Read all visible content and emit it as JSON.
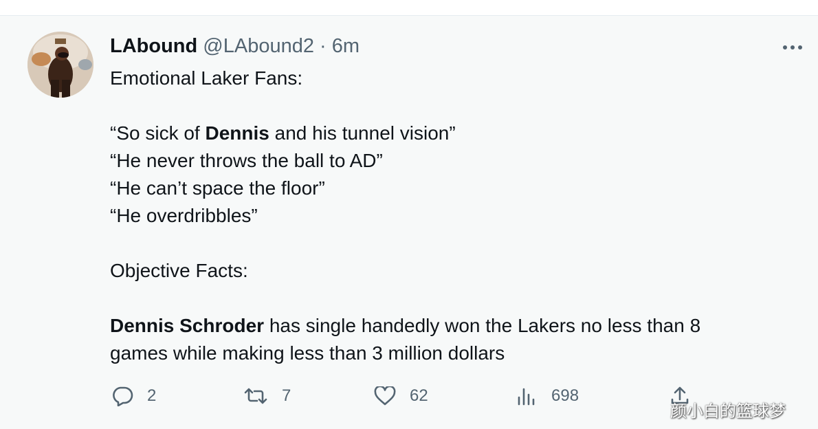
{
  "tweet": {
    "author": {
      "display_name": "LAbound",
      "handle": "@LAbound2",
      "separator": "·",
      "time": "6m"
    },
    "body": {
      "intro": "Emotional Laker Fans:",
      "quotes": [
        {
          "before": "“So sick of ",
          "bold": "Dennis",
          "after": " and his tunnel vision”"
        },
        {
          "text": "“He never throws the ball to AD”"
        },
        {
          "text": "“He can’t space the floor”"
        },
        {
          "text": "“He overdribbles”"
        }
      ],
      "facts_heading": "Objective Facts:",
      "fact": {
        "bold": "Dennis Schroder",
        "text_line1": " has single handedly won the Lakers no less than 8",
        "text_line2": "games while making less than 3 million dollars"
      }
    },
    "actions": {
      "replies": {
        "icon": "reply-icon",
        "count": "2"
      },
      "retweets": {
        "icon": "retweet-icon",
        "count": "7"
      },
      "likes": {
        "icon": "heart-icon",
        "count": "62"
      },
      "views": {
        "icon": "analytics-icon",
        "count": "698"
      },
      "share": {
        "icon": "share-icon"
      }
    },
    "more_icon": "more-icon"
  },
  "watermark": {
    "text": "颜小白的篮球梦"
  },
  "colors": {
    "text": "#0f1419",
    "secondary": "#536471",
    "background": "#f7f9f9"
  }
}
